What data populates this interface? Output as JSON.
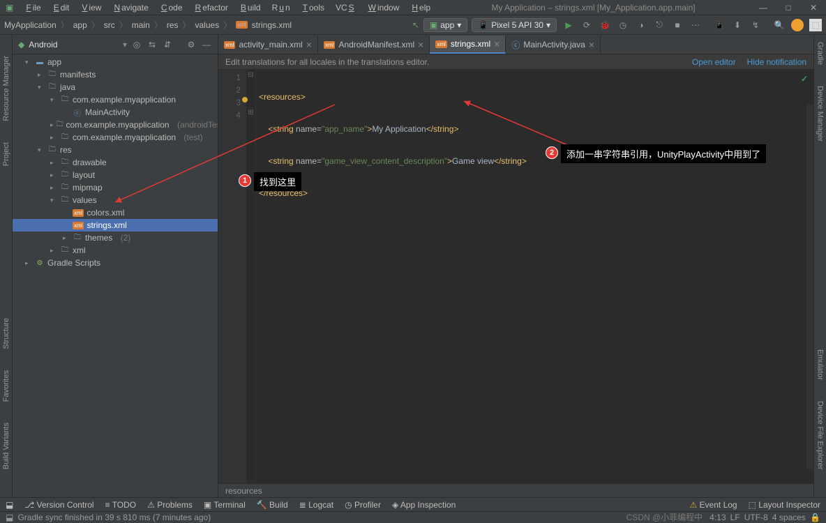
{
  "window": {
    "title": "My Application – strings.xml [My_Application.app.main]",
    "menu": [
      "File",
      "Edit",
      "View",
      "Navigate",
      "Code",
      "Refactor",
      "Build",
      "Run",
      "Tools",
      "VCS",
      "Window",
      "Help"
    ]
  },
  "toolbar": {
    "breadcrumbs": [
      "MyApplication",
      "app",
      "src",
      "main",
      "res",
      "values",
      "strings.xml"
    ],
    "config": "app",
    "device": "Pixel 5 API 30"
  },
  "project": {
    "viewMode": "Android",
    "tree": {
      "app": "app",
      "manifests": "manifests",
      "java": "java",
      "pkg": "com.example.myapplication",
      "mainActivity": "MainActivity",
      "pkgAndroidTest": "com.example.myapplication",
      "pkgAndroidTestSuf": "(androidTest)",
      "pkgTest": "com.example.myapplication",
      "pkgTestSuf": "(test)",
      "res": "res",
      "drawable": "drawable",
      "layout": "layout",
      "mipmap": "mipmap",
      "values": "values",
      "colors": "colors.xml",
      "strings": "strings.xml",
      "themes": "themes",
      "themesCount": "(2)",
      "xml": "xml",
      "gradle": "Gradle Scripts"
    }
  },
  "tabs": [
    {
      "label": "activity_main.xml"
    },
    {
      "label": "AndroidManifest.xml"
    },
    {
      "label": "strings.xml"
    },
    {
      "label": "MainActivity.java"
    }
  ],
  "infobar": {
    "msg": "Edit translations for all locales in the translations editor.",
    "link1": "Open editor",
    "link2": "Hide notification"
  },
  "code": {
    "lines": [
      "1",
      "2",
      "3",
      "4"
    ],
    "l1": {
      "t1": "<resources>"
    },
    "l2": {
      "t1": "    <string ",
      "attr": "name=",
      "val": "\"app_name\"",
      "t2": ">",
      "txt": "My Application",
      "t3": "</string>"
    },
    "l3": {
      "t1": "    <string ",
      "attr": "name=",
      "val": "\"game_view_content_description\"",
      "t2": ">",
      "txt": "Game view",
      "t3": "</string>"
    },
    "l4": {
      "t1": "</resources>"
    }
  },
  "footerCrumb": "resources",
  "bottom": [
    "Version Control",
    "TODO",
    "Problems",
    "Terminal",
    "Build",
    "Logcat",
    "Profiler",
    "App Inspection"
  ],
  "bottomRight": {
    "eventlog": "Event Log",
    "layout": "Layout Inspector"
  },
  "status": {
    "msg": "Gradle sync finished in 39 s 810 ms (7 minutes ago)",
    "pos": "4:13",
    "enc": "LF",
    "utf": "UTF-8",
    "spaces": "4 spaces",
    "watermark": "CSDN @小菲编程中"
  },
  "annotations": {
    "n1": "找到这里",
    "n2": "添加一串字符串引用，UnityPlayActivity中用到了"
  },
  "sidebars": {
    "left": [
      "Resource Manager",
      "Project"
    ],
    "leftBottom": [
      "Structure",
      "Favorites",
      "Build Variants"
    ],
    "right": [
      "Gradle",
      "Device Manager"
    ],
    "rightBottom": [
      "Emulator",
      "Device File Explorer"
    ]
  }
}
